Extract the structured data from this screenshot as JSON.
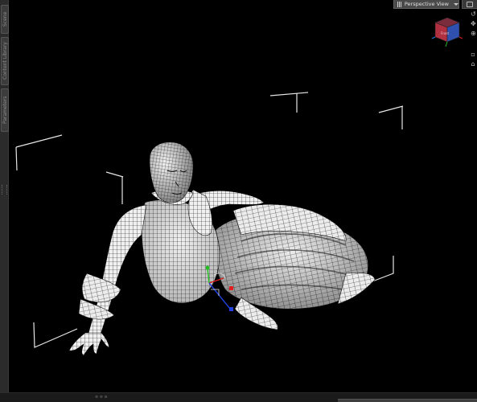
{
  "viewport": {
    "view_label": "Perspective View",
    "camera_cube_label": "Front"
  },
  "side_pane": {
    "tabs": [
      "Scene",
      "Content Library",
      "Parameters"
    ]
  },
  "status": {
    "tiny_label": "≡ ≡ ≡"
  },
  "colors": {
    "background": "#000000",
    "wire": "#e8e8e8",
    "gizmo_x": "#e02020",
    "gizmo_y": "#20c020",
    "gizmo_z": "#2040e0",
    "cube_red": "#b03040",
    "cube_blue": "#3050b0"
  }
}
